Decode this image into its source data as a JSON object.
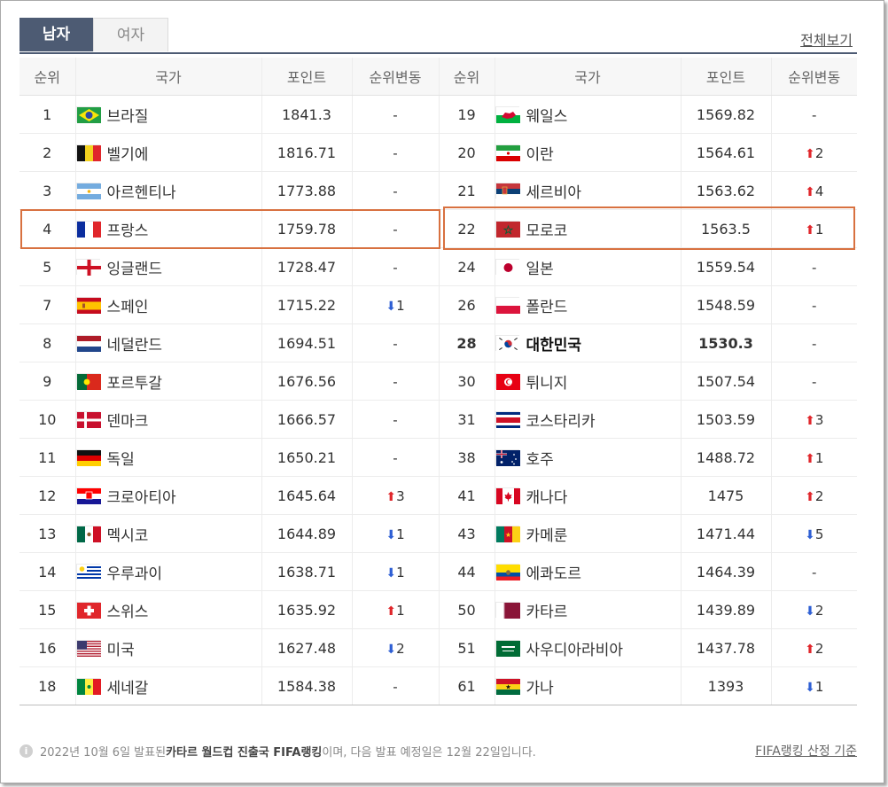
{
  "tabs": [
    "남자",
    "여자"
  ],
  "view_all": "전체보기",
  "headers": [
    "순위",
    "국가",
    "포인트",
    "순위변동",
    "순위",
    "국가",
    "포인트",
    "순위변동"
  ],
  "left": [
    {
      "rank": "1",
      "country": "브라질",
      "points": "1841.3",
      "change": "-",
      "flag": "brazil"
    },
    {
      "rank": "2",
      "country": "벨기에",
      "points": "1816.71",
      "change": "-",
      "flag": "belgium"
    },
    {
      "rank": "3",
      "country": "아르헨티나",
      "points": "1773.88",
      "change": "-",
      "flag": "argentina"
    },
    {
      "rank": "4",
      "country": "프랑스",
      "points": "1759.78",
      "change": "-",
      "flag": "france"
    },
    {
      "rank": "5",
      "country": "잉글랜드",
      "points": "1728.47",
      "change": "-",
      "flag": "england"
    },
    {
      "rank": "7",
      "country": "스페인",
      "points": "1715.22",
      "change": "1",
      "dir": "down",
      "flag": "spain"
    },
    {
      "rank": "8",
      "country": "네덜란드",
      "points": "1694.51",
      "change": "-",
      "flag": "netherlands"
    },
    {
      "rank": "9",
      "country": "포르투갈",
      "points": "1676.56",
      "change": "-",
      "flag": "portugal"
    },
    {
      "rank": "10",
      "country": "덴마크",
      "points": "1666.57",
      "change": "-",
      "flag": "denmark"
    },
    {
      "rank": "11",
      "country": "독일",
      "points": "1650.21",
      "change": "-",
      "flag": "germany"
    },
    {
      "rank": "12",
      "country": "크로아티아",
      "points": "1645.64",
      "change": "3",
      "dir": "up",
      "flag": "croatia"
    },
    {
      "rank": "13",
      "country": "멕시코",
      "points": "1644.89",
      "change": "1",
      "dir": "down",
      "flag": "mexico"
    },
    {
      "rank": "14",
      "country": "우루과이",
      "points": "1638.71",
      "change": "1",
      "dir": "down",
      "flag": "uruguay"
    },
    {
      "rank": "15",
      "country": "스위스",
      "points": "1635.92",
      "change": "1",
      "dir": "up",
      "flag": "switzerland"
    },
    {
      "rank": "16",
      "country": "미국",
      "points": "1627.48",
      "change": "2",
      "dir": "down",
      "flag": "usa"
    },
    {
      "rank": "18",
      "country": "세네갈",
      "points": "1584.38",
      "change": "-",
      "flag": "senegal"
    }
  ],
  "right": [
    {
      "rank": "19",
      "country": "웨일스",
      "points": "1569.82",
      "change": "-",
      "flag": "wales"
    },
    {
      "rank": "20",
      "country": "이란",
      "points": "1564.61",
      "change": "2",
      "dir": "up",
      "flag": "iran"
    },
    {
      "rank": "21",
      "country": "세르비아",
      "points": "1563.62",
      "change": "4",
      "dir": "up",
      "flag": "serbia"
    },
    {
      "rank": "22",
      "country": "모로코",
      "points": "1563.5",
      "change": "1",
      "dir": "up",
      "flag": "morocco"
    },
    {
      "rank": "24",
      "country": "일본",
      "points": "1559.54",
      "change": "-",
      "flag": "japan"
    },
    {
      "rank": "26",
      "country": "폴란드",
      "points": "1548.59",
      "change": "-",
      "flag": "poland"
    },
    {
      "rank": "28",
      "country": "대한민국",
      "points": "1530.3",
      "change": "-",
      "flag": "korea",
      "bold": true
    },
    {
      "rank": "30",
      "country": "튀니지",
      "points": "1507.54",
      "change": "-",
      "flag": "tunisia"
    },
    {
      "rank": "31",
      "country": "코스타리카",
      "points": "1503.59",
      "change": "3",
      "dir": "up",
      "flag": "costarica"
    },
    {
      "rank": "38",
      "country": "호주",
      "points": "1488.72",
      "change": "1",
      "dir": "up",
      "flag": "australia"
    },
    {
      "rank": "41",
      "country": "캐나다",
      "points": "1475",
      "change": "2",
      "dir": "up",
      "flag": "canada"
    },
    {
      "rank": "43",
      "country": "카메룬",
      "points": "1471.44",
      "change": "5",
      "dir": "down",
      "flag": "cameroon"
    },
    {
      "rank": "44",
      "country": "에콰도르",
      "points": "1464.39",
      "change": "-",
      "flag": "ecuador"
    },
    {
      "rank": "50",
      "country": "카타르",
      "points": "1439.89",
      "change": "2",
      "dir": "down",
      "flag": "qatar"
    },
    {
      "rank": "51",
      "country": "사우디아라비아",
      "points": "1437.78",
      "change": "2",
      "dir": "up",
      "flag": "saudi"
    },
    {
      "rank": "61",
      "country": "가나",
      "points": "1393",
      "change": "1",
      "dir": "down",
      "flag": "ghana"
    }
  ],
  "footer": {
    "pre": "2022년 10월 6일 발표된 ",
    "strong": "카타르 월드컵 진출국 FIFA랭킹",
    "post": "이며, 다음 발표 예정일은 12월 22일입니다.",
    "link": "FIFA랭킹 산정 기준"
  },
  "colors": {
    "tab_active": "#4d5b73",
    "up": "#e0262b",
    "down": "#2e5fd4",
    "highlight": "#d87140"
  }
}
